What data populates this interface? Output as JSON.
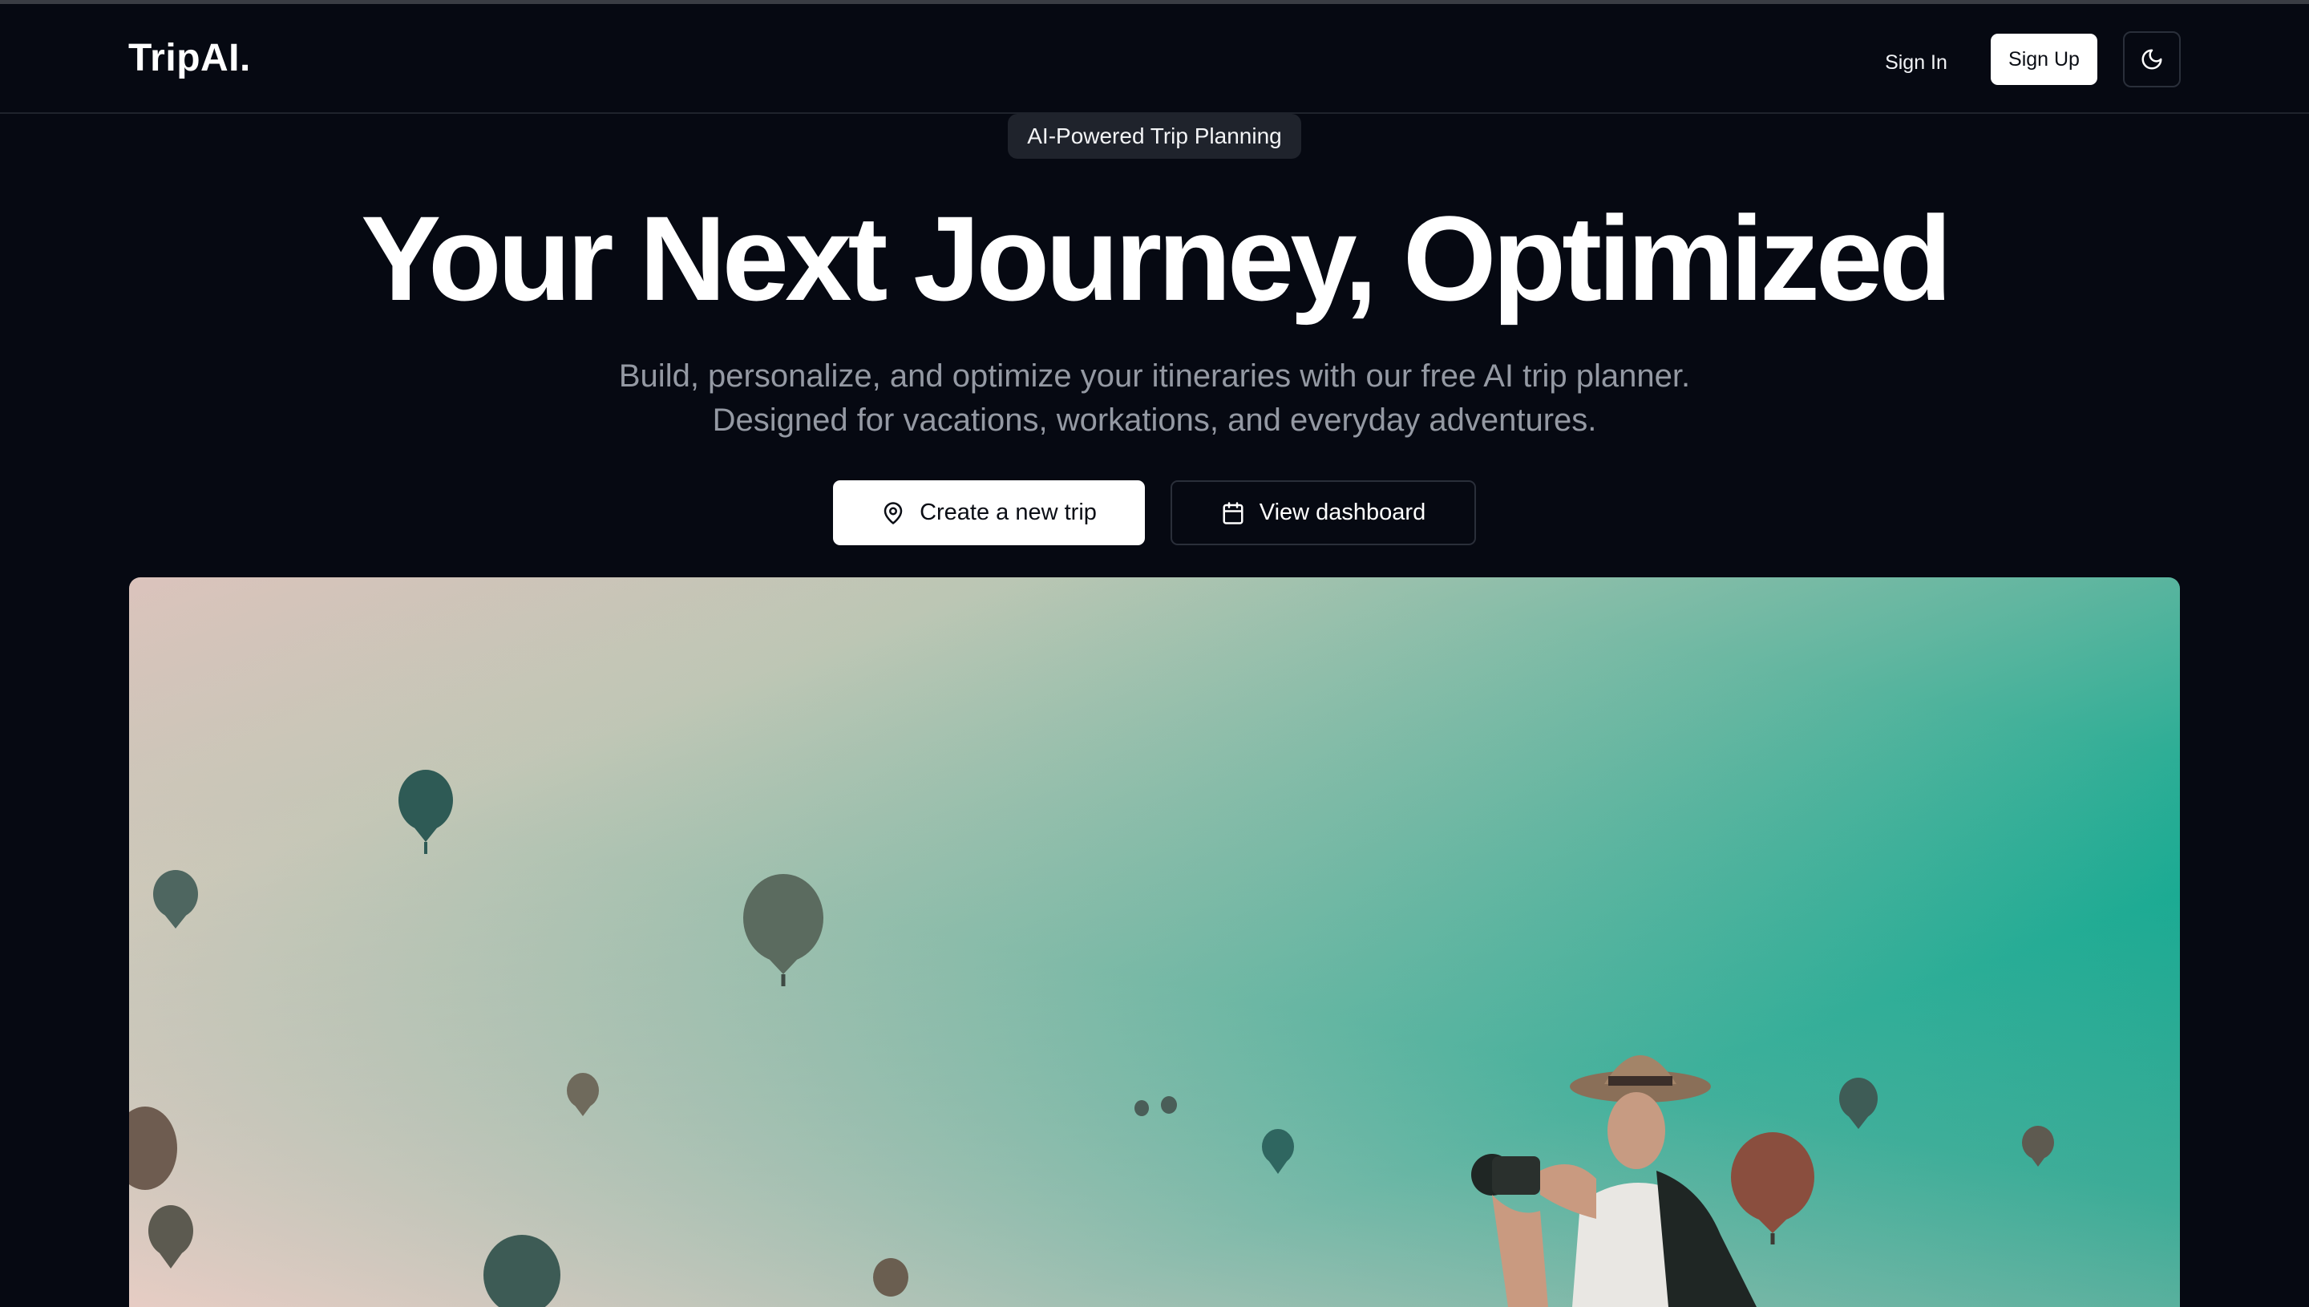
{
  "brand": {
    "logo": "TripAI."
  },
  "nav": {
    "sign_in": "Sign In",
    "sign_up": "Sign Up",
    "theme_icon": "moon-icon"
  },
  "hero": {
    "badge": "AI-Powered Trip Planning",
    "title": "Your Next Journey, Optimized",
    "subtitle_line1": "Build, personalize, and optimize your itineraries with our free AI trip planner.",
    "subtitle_line2": "Designed for vacations, workations, and everyday adventures.",
    "primary_button": {
      "label": "Create a new trip",
      "icon": "map-pin-icon"
    },
    "secondary_button": {
      "label": "View dashboard",
      "icon": "calendar-icon"
    },
    "image": {
      "subject": "hot-air-balloons-photographer"
    }
  },
  "colors": {
    "background": "#060912",
    "accent_teal": "#00a087",
    "button_light": "#ffffff",
    "muted_text": "#9499a3"
  }
}
